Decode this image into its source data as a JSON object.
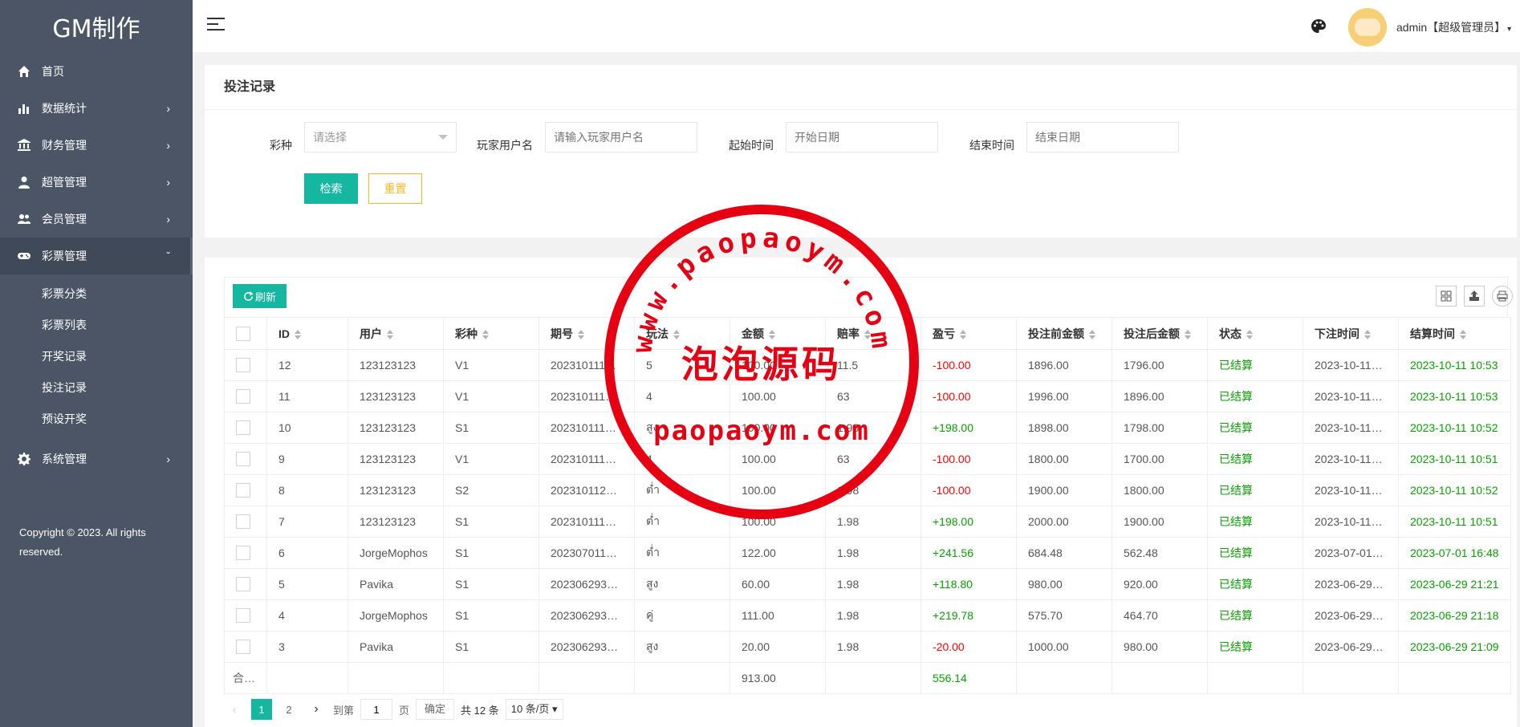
{
  "app": {
    "logo": "GM制作"
  },
  "sidebar": {
    "items": [
      {
        "label": "首页",
        "icon": "home-icon",
        "has_children": false
      },
      {
        "label": "数据统计",
        "icon": "bar-chart-icon",
        "has_children": true
      },
      {
        "label": "财务管理",
        "icon": "bank-icon",
        "has_children": true
      },
      {
        "label": "超管管理",
        "icon": "user-icon",
        "has_children": true
      },
      {
        "label": "会员管理",
        "icon": "users-icon",
        "has_children": true
      },
      {
        "label": "彩票管理",
        "icon": "gamepad-icon",
        "has_children": true,
        "expanded": true
      }
    ],
    "submenu": [
      "彩票分类",
      "彩票列表",
      "开奖记录",
      "投注记录",
      "预设开奖"
    ],
    "system": {
      "label": "系统管理",
      "icon": "gear-icon"
    },
    "chevron_right": "›",
    "chevron_down": "ˇ",
    "copyright": "Copyright © 2023. All rights reserved."
  },
  "header": {
    "user": "admin【超级管理员】",
    "caret": "▾"
  },
  "filters": {
    "title": "投注记录",
    "lottery_label": "彩种",
    "lottery_placeholder": "请选择",
    "player_label": "玩家用户名",
    "player_placeholder": "请输入玩家用户名",
    "start_label": "起始时间",
    "start_placeholder": "开始日期",
    "end_label": "结束时间",
    "end_placeholder": "结束日期",
    "search_label": "检索",
    "reset_label": "重置"
  },
  "table": {
    "refresh_label": "刷新",
    "columns": [
      "ID",
      "用户",
      "彩种",
      "期号",
      "玩法",
      "金额",
      "赔率",
      "盈亏",
      "投注前金额",
      "投注后金额",
      "状态",
      "下注时间",
      "结算时间"
    ],
    "rows": [
      {
        "id": "12",
        "user": "123123123",
        "lottery": "V1",
        "period": "202310111…",
        "play": "5",
        "amount": "100.00",
        "odds": "11.5",
        "profit": "-100.00",
        "before": "1896.00",
        "after": "1796.00",
        "status": "已结算",
        "bet_time": "2023-10-11…",
        "settle_time": "2023-10-11 10:53"
      },
      {
        "id": "11",
        "user": "123123123",
        "lottery": "V1",
        "period": "202310111…",
        "play": "4",
        "amount": "100.00",
        "odds": "63",
        "profit": "-100.00",
        "before": "1996.00",
        "after": "1896.00",
        "status": "已结算",
        "bet_time": "2023-10-11…",
        "settle_time": "2023-10-11 10:53"
      },
      {
        "id": "10",
        "user": "123123123",
        "lottery": "S1",
        "period": "202310111…",
        "play": "สูง",
        "amount": "100.00",
        "odds": "1.98",
        "profit": "+198.00",
        "before": "1898.00",
        "after": "1798.00",
        "status": "已结算",
        "bet_time": "2023-10-11…",
        "settle_time": "2023-10-11 10:52"
      },
      {
        "id": "9",
        "user": "123123123",
        "lottery": "V1",
        "period": "202310111…",
        "play": "4",
        "amount": "100.00",
        "odds": "63",
        "profit": "-100.00",
        "before": "1800.00",
        "after": "1700.00",
        "status": "已结算",
        "bet_time": "2023-10-11…",
        "settle_time": "2023-10-11 10:51"
      },
      {
        "id": "8",
        "user": "123123123",
        "lottery": "S2",
        "period": "202310112…",
        "play": "ต่ำ",
        "amount": "100.00",
        "odds": "1.98",
        "profit": "-100.00",
        "before": "1900.00",
        "after": "1800.00",
        "status": "已结算",
        "bet_time": "2023-10-11…",
        "settle_time": "2023-10-11 10:52"
      },
      {
        "id": "7",
        "user": "123123123",
        "lottery": "S1",
        "period": "202310111…",
        "play": "ต่ำ",
        "amount": "100.00",
        "odds": "1.98",
        "profit": "+198.00",
        "before": "2000.00",
        "after": "1900.00",
        "status": "已结算",
        "bet_time": "2023-10-11…",
        "settle_time": "2023-10-11 10:51"
      },
      {
        "id": "6",
        "user": "JorgeMophos",
        "lottery": "S1",
        "period": "202307011…",
        "play": "ต่ำ",
        "amount": "122.00",
        "odds": "1.98",
        "profit": "+241.56",
        "before": "684.48",
        "after": "562.48",
        "status": "已结算",
        "bet_time": "2023-07-01…",
        "settle_time": "2023-07-01 16:48"
      },
      {
        "id": "5",
        "user": "Pavika",
        "lottery": "S1",
        "period": "202306293…",
        "play": "สูง",
        "amount": "60.00",
        "odds": "1.98",
        "profit": "+118.80",
        "before": "980.00",
        "after": "920.00",
        "status": "已结算",
        "bet_time": "2023-06-29…",
        "settle_time": "2023-06-29 21:21"
      },
      {
        "id": "4",
        "user": "JorgeMophos",
        "lottery": "S1",
        "period": "202306293…",
        "play": "คู่",
        "amount": "111.00",
        "odds": "1.98",
        "profit": "+219.78",
        "before": "575.70",
        "after": "464.70",
        "status": "已结算",
        "bet_time": "2023-06-29…",
        "settle_time": "2023-06-29 21:18"
      },
      {
        "id": "3",
        "user": "Pavika",
        "lottery": "S1",
        "period": "202306293…",
        "play": "สูง",
        "amount": "20.00",
        "odds": "1.98",
        "profit": "-20.00",
        "before": "1000.00",
        "after": "980.00",
        "status": "已结算",
        "bet_time": "2023-06-29…",
        "settle_time": "2023-06-29 21:09"
      }
    ],
    "total": {
      "label": "合…",
      "amount": "913.00",
      "profit": "556.14"
    }
  },
  "pagination": {
    "prev": "‹",
    "pages": [
      "1",
      "2"
    ],
    "next": "›",
    "goto_label": "到第",
    "goto_value": "1",
    "page_unit": "页",
    "confirm_label": "确定",
    "total_label": "共 12 条",
    "page_size_label": "10 条/页"
  },
  "watermark": {
    "url_top": "www.paopaoym.com",
    "chinese": "泡泡源码",
    "url_bottom": "paopaoym.com",
    "color": "#e60012"
  },
  "colors": {
    "sidebar_bg": "#4b5565",
    "accent": "#16b7a0",
    "reset": "#f7b824",
    "loss": "#ff0000",
    "gain": "#08a200"
  }
}
